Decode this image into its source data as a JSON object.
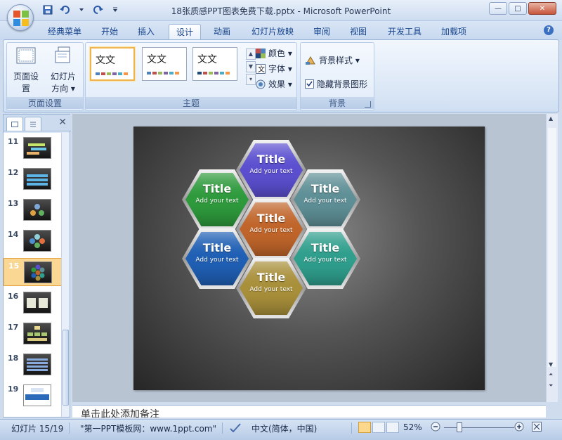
{
  "window": {
    "title": "18张质感PPT图表免费下载.pptx - Microsoft PowerPoint",
    "controls": [
      "—",
      "□",
      "✕"
    ]
  },
  "ribbon_tabs": [
    {
      "label": "经典菜单",
      "active": false
    },
    {
      "label": "开始",
      "active": false
    },
    {
      "label": "插入",
      "active": false
    },
    {
      "label": "设计",
      "active": true
    },
    {
      "label": "动画",
      "active": false
    },
    {
      "label": "幻灯片放映",
      "active": false
    },
    {
      "label": "审阅",
      "active": false
    },
    {
      "label": "视图",
      "active": false
    },
    {
      "label": "开发工具",
      "active": false
    },
    {
      "label": "加载项",
      "active": false
    }
  ],
  "page_setup_group": {
    "label": "页面设置",
    "page_setup_button": "页面设置",
    "orientation_button": [
      "幻灯片",
      "方向 ▾"
    ]
  },
  "themes_group": {
    "label": "主题",
    "thumbnails": [
      {
        "text": "文文",
        "selected": true
      },
      {
        "text": "文文",
        "selected": false
      },
      {
        "text": "文文",
        "selected": false
      }
    ],
    "colors_button": "颜色 ▾",
    "fonts_button": "字体 ▾",
    "effects_button": "效果 ▾"
  },
  "background_group": {
    "label": "背景",
    "styles_button": "背景样式 ▾",
    "hide_graphics_checkbox": {
      "label": "隐藏背景图形",
      "checked": true
    }
  },
  "slides_panel": {
    "close_glyph": "✕",
    "items": [
      {
        "number": "11",
        "selected": false
      },
      {
        "number": "12",
        "selected": false
      },
      {
        "number": "13",
        "selected": false
      },
      {
        "number": "14",
        "selected": false
      },
      {
        "number": "15",
        "selected": true
      },
      {
        "number": "16",
        "selected": false
      },
      {
        "number": "17",
        "selected": false
      },
      {
        "number": "18",
        "selected": false
      },
      {
        "number": "19",
        "selected": false
      }
    ]
  },
  "slide": {
    "hexagons": [
      {
        "id": "top",
        "title": "Title",
        "subtitle": "Add your text",
        "color": "#5b4fcf"
      },
      {
        "id": "upper-left",
        "title": "Title",
        "subtitle": "Add your text",
        "color": "#2e9a3c"
      },
      {
        "id": "upper-right",
        "title": "Title",
        "subtitle": "Add your text",
        "color": "#5e8f96"
      },
      {
        "id": "center",
        "title": "Title",
        "subtitle": "Add your text",
        "color": "#c0652a"
      },
      {
        "id": "lower-left",
        "title": "Title",
        "subtitle": "Add your text",
        "color": "#1f5fb4"
      },
      {
        "id": "lower-right",
        "title": "Title",
        "subtitle": "Add your text",
        "color": "#2f9e8c"
      },
      {
        "id": "bottom",
        "title": "Title",
        "subtitle": "Add your text",
        "color": "#a88f3a"
      }
    ]
  },
  "notes": {
    "placeholder": "单击此处添加备注"
  },
  "status_bar": {
    "slide_position": "幻灯片 15/19",
    "theme_name": "\"第一PPT模板网：www.1ppt.com\"",
    "language": "中文(简体，中国)",
    "zoom": "52%"
  },
  "colors": {
    "ribbon_accent": "#15428b",
    "selection": "#fad792"
  }
}
